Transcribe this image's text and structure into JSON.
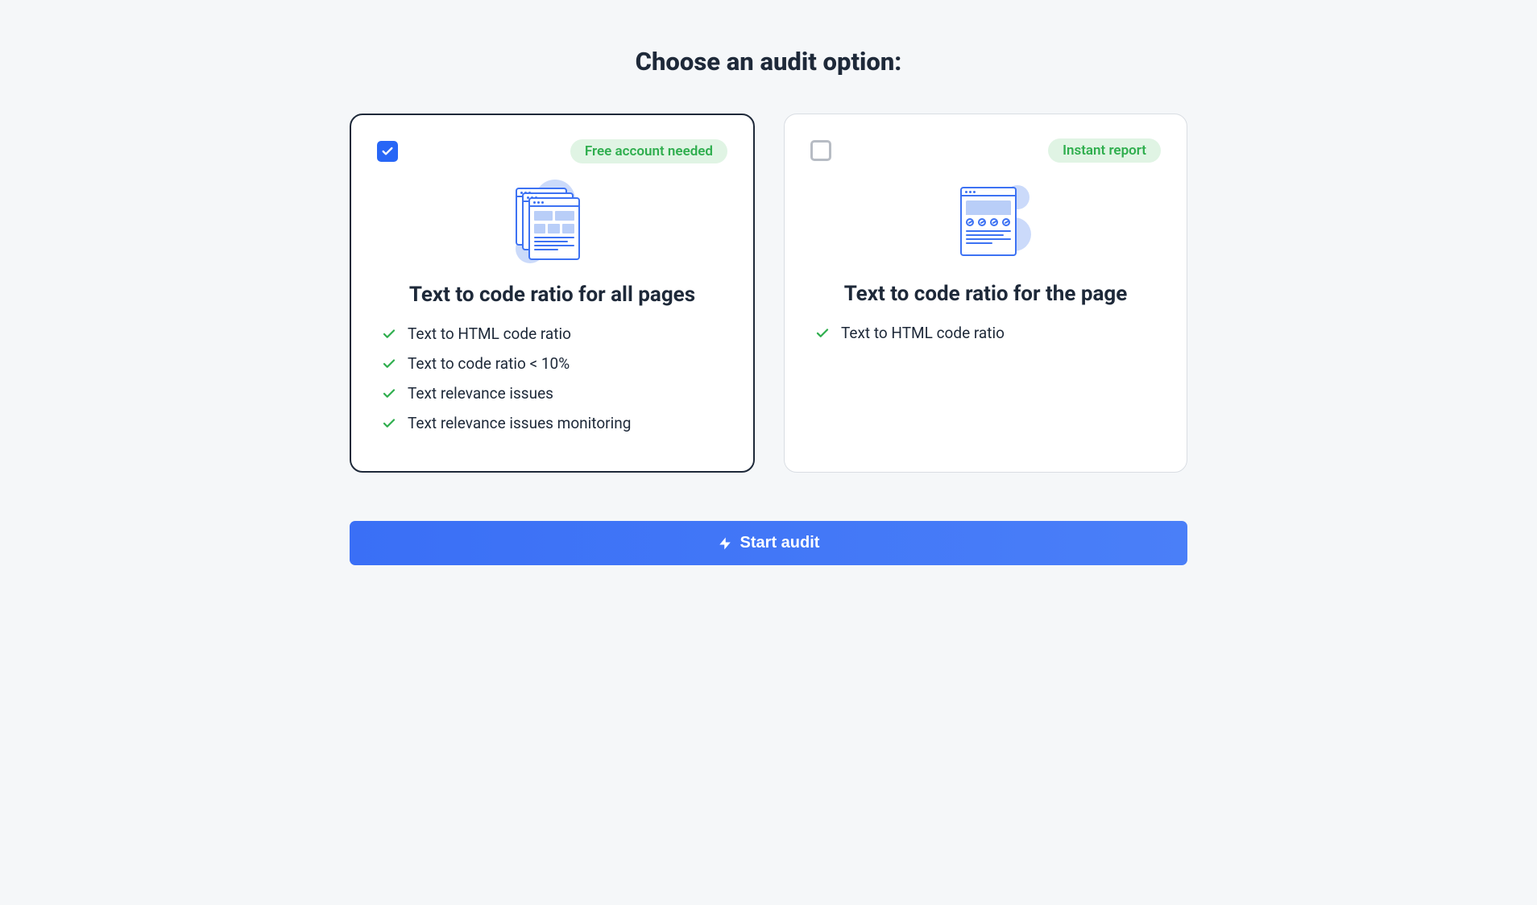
{
  "title": "Choose an audit option:",
  "options": [
    {
      "selected": true,
      "badge": "Free account needed",
      "title": "Text to code ratio for all pages",
      "features": [
        "Text to HTML code ratio",
        "Text to code ratio < 10%",
        "Text relevance issues",
        "Text relevance issues monitoring"
      ]
    },
    {
      "selected": false,
      "badge": "Instant report",
      "title": "Text to code ratio for the page",
      "features": [
        "Text to HTML code ratio"
      ]
    }
  ],
  "cta": "Start audit"
}
